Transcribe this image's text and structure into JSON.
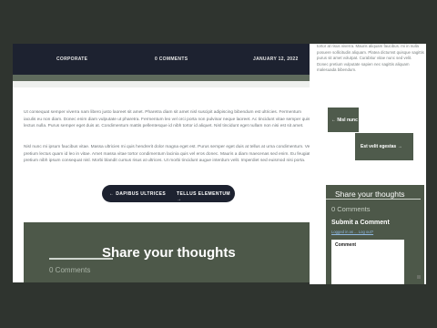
{
  "post_meta": {
    "category": "CORPORATE",
    "comments": "0 COMMENTS",
    "date": "JANUARY 12, 2022"
  },
  "content": {
    "paragraph_1": "Ut consequat semper viverra nam libero justo laoreet sit amet. Pharetra diam sit amet nisl suscipit adipiscing bibendum est ultricies. Fermentum iaculis eu non diam. Donec enim diam vulputate ut pharetra. Fermentum leo vel orci porta non pulvinar neque laoreet. Ac tincidunt vitae semper quis lectus nulla. Purus semper eget duis at. Condimentum mattis pellentesque id nibh tortor id aliquet. Nisl tincidunt eget nullam non nisi est sit amet.",
    "paragraph_2": "Nisl nunc mi ipsum faucibus vitae. Massa ultricies mi quis hendrerit dolor magna eget est. Purus semper eget duis at tellus at urna condimentum. Vel pretium lectus quam id leo in vitae. Amet massa vitae tortor condimentum lacinia quis vel eros donec. Mauris a diam maecenas sed enim. Eu feugiat pretium nibh ipsum consequat nisl. Morbi blandit cursus risus at ultrices. Ut morbi tincidunt augue interdum velit. Imperdiet sed euismod nisi porta."
  },
  "post_navigation": {
    "prev_label": "← DAPIBUS ULTRICES",
    "next_label": "TELLUS ELEMENTUM →"
  },
  "comments_section": {
    "title": "Share your thoughts",
    "count": "0 Comments"
  },
  "sidebar": {
    "text_excerpt": "tortor at risus viverra. Mauris aliquam faucibus. mi in nulla posuere sollicitudin aliquam. Platea dictumst quisque sagittis purus sit amet volutpat. Curabitur vitae nunc sed velit. Donec pretium vulputate sapien nec sagittis aliquam malesuada bibendum.",
    "nav_prev_label": "← Nisl nunc",
    "nav_next_label": "Est velit egestas →",
    "comment_title": "Share your thoughts",
    "comment_count": "0 Comments",
    "submit_heading": "Submit a Comment",
    "logged_in_text": "Logged in as ... Log out?",
    "comment_field_label": "Comment"
  },
  "colors": {
    "meta_bar": "#1d2230",
    "accent_green": "#4d5849",
    "page_background": "#2f342f"
  }
}
